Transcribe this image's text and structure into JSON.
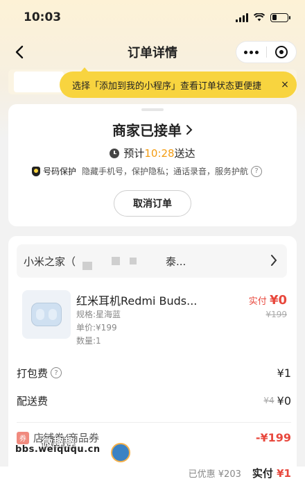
{
  "status_bar": {
    "time": "10:03"
  },
  "nav": {
    "title": "订单详情"
  },
  "tooltip": {
    "text": "选择「添加到我的小程序」查看订单状态更便捷",
    "close": "×"
  },
  "order_status": {
    "title": "商家已接单",
    "eta_prefix": "预计",
    "eta_time": "10:28",
    "eta_suffix": "送达",
    "privacy_title": "号码保护",
    "privacy_desc": "隐藏手机号，保护隐私；通话录音，服务护航",
    "cancel_label": "取消订单"
  },
  "store": {
    "name": "小米之家（",
    "name_tail": "泰..."
  },
  "product": {
    "name": "红米耳机Redmi Buds...",
    "spec": "规格:星海蓝",
    "unit_price": "单价:¥199",
    "quantity": "数量:1",
    "paid_label": "实付",
    "paid_amount": "¥0",
    "original_price": "¥199"
  },
  "fees": {
    "packing_label": "打包费",
    "packing_value": "¥1",
    "delivery_label": "配送费",
    "delivery_original": "¥4",
    "delivery_value": "¥0"
  },
  "coupon": {
    "icon_text": "券",
    "label": "店铺券/商品券",
    "value": "-¥199"
  },
  "watermark": {
    "cn": "微趣趣",
    "url": "bbs.weiququ.cn"
  },
  "summary": {
    "discount": "已优惠 ¥203",
    "paid_label": "实付",
    "paid_amount": "¥1"
  },
  "colors": {
    "accent_yellow": "#f8d43f",
    "price_red": "#e8483d",
    "eta_orange": "#f39c12"
  }
}
